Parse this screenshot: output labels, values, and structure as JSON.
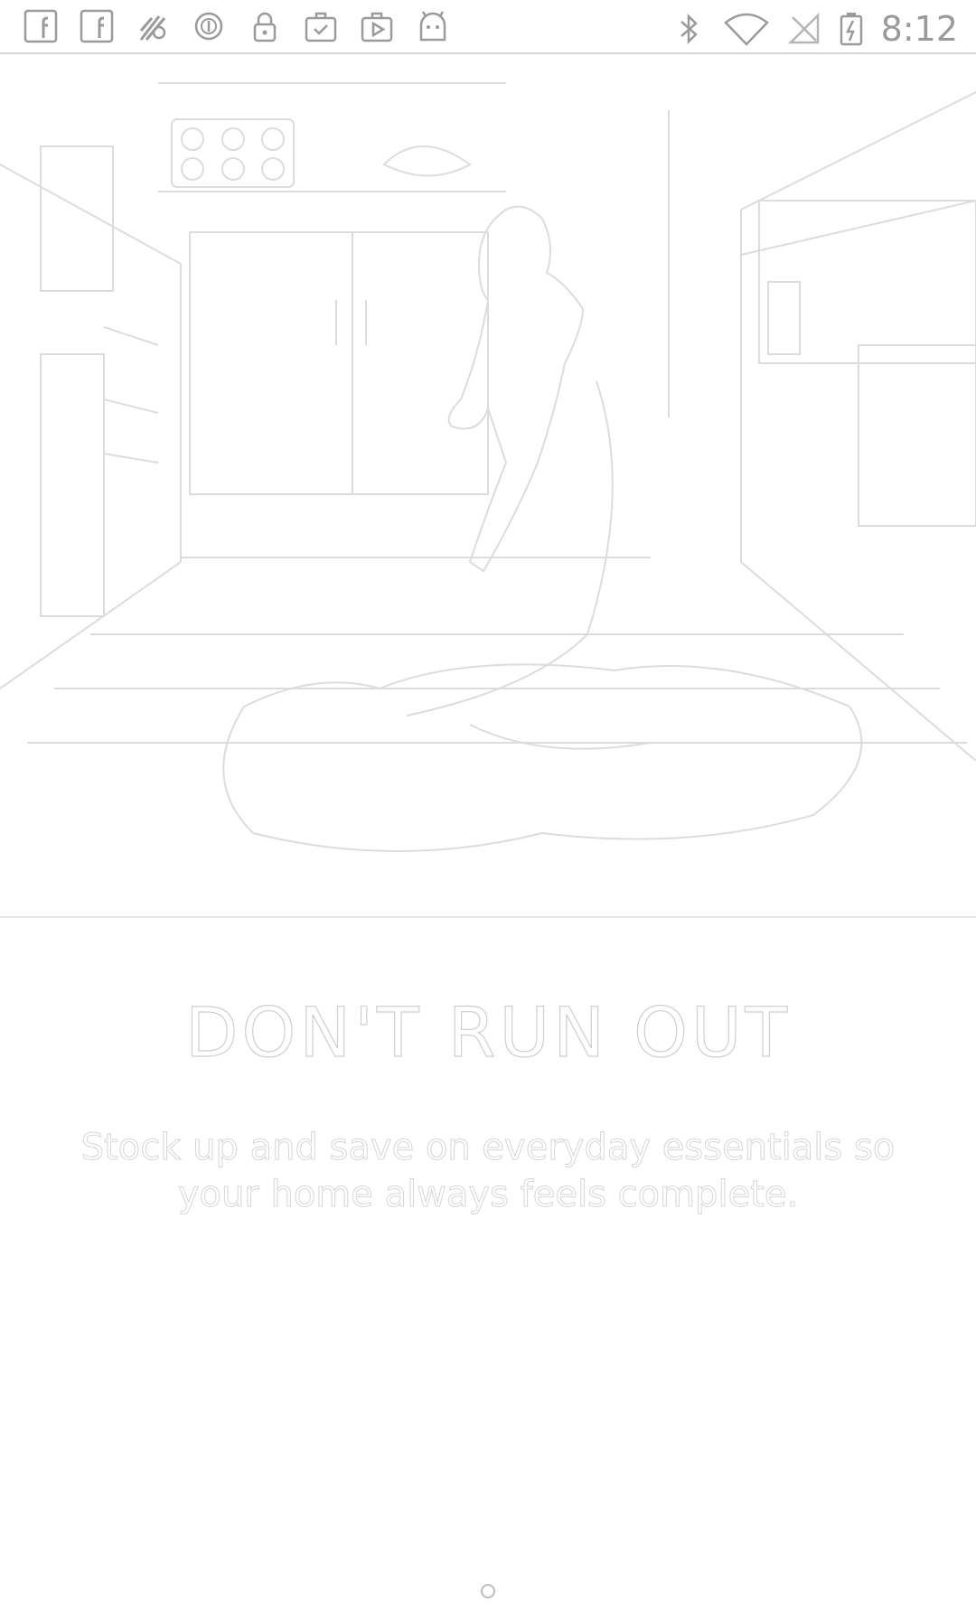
{
  "status_bar": {
    "left_icons": [
      "facebook-icon",
      "facebook-icon",
      "fast-app-icon",
      "vpn-icon",
      "lock-icon",
      "briefcase-check-icon",
      "play-store-icon",
      "android-icon"
    ],
    "right_icons": [
      "bluetooth-icon",
      "wifi-icon",
      "no-signal-icon",
      "battery-charging-icon"
    ],
    "time": "8:12"
  },
  "onboarding": {
    "title": "DON'T RUN OUT",
    "subtitle": "Stock up and save on everyday essentials so your home always feels complete.",
    "page_count": 1,
    "active_page": 1
  },
  "colors": {
    "outline": "#cfcfcf",
    "background": "#ffffff"
  }
}
